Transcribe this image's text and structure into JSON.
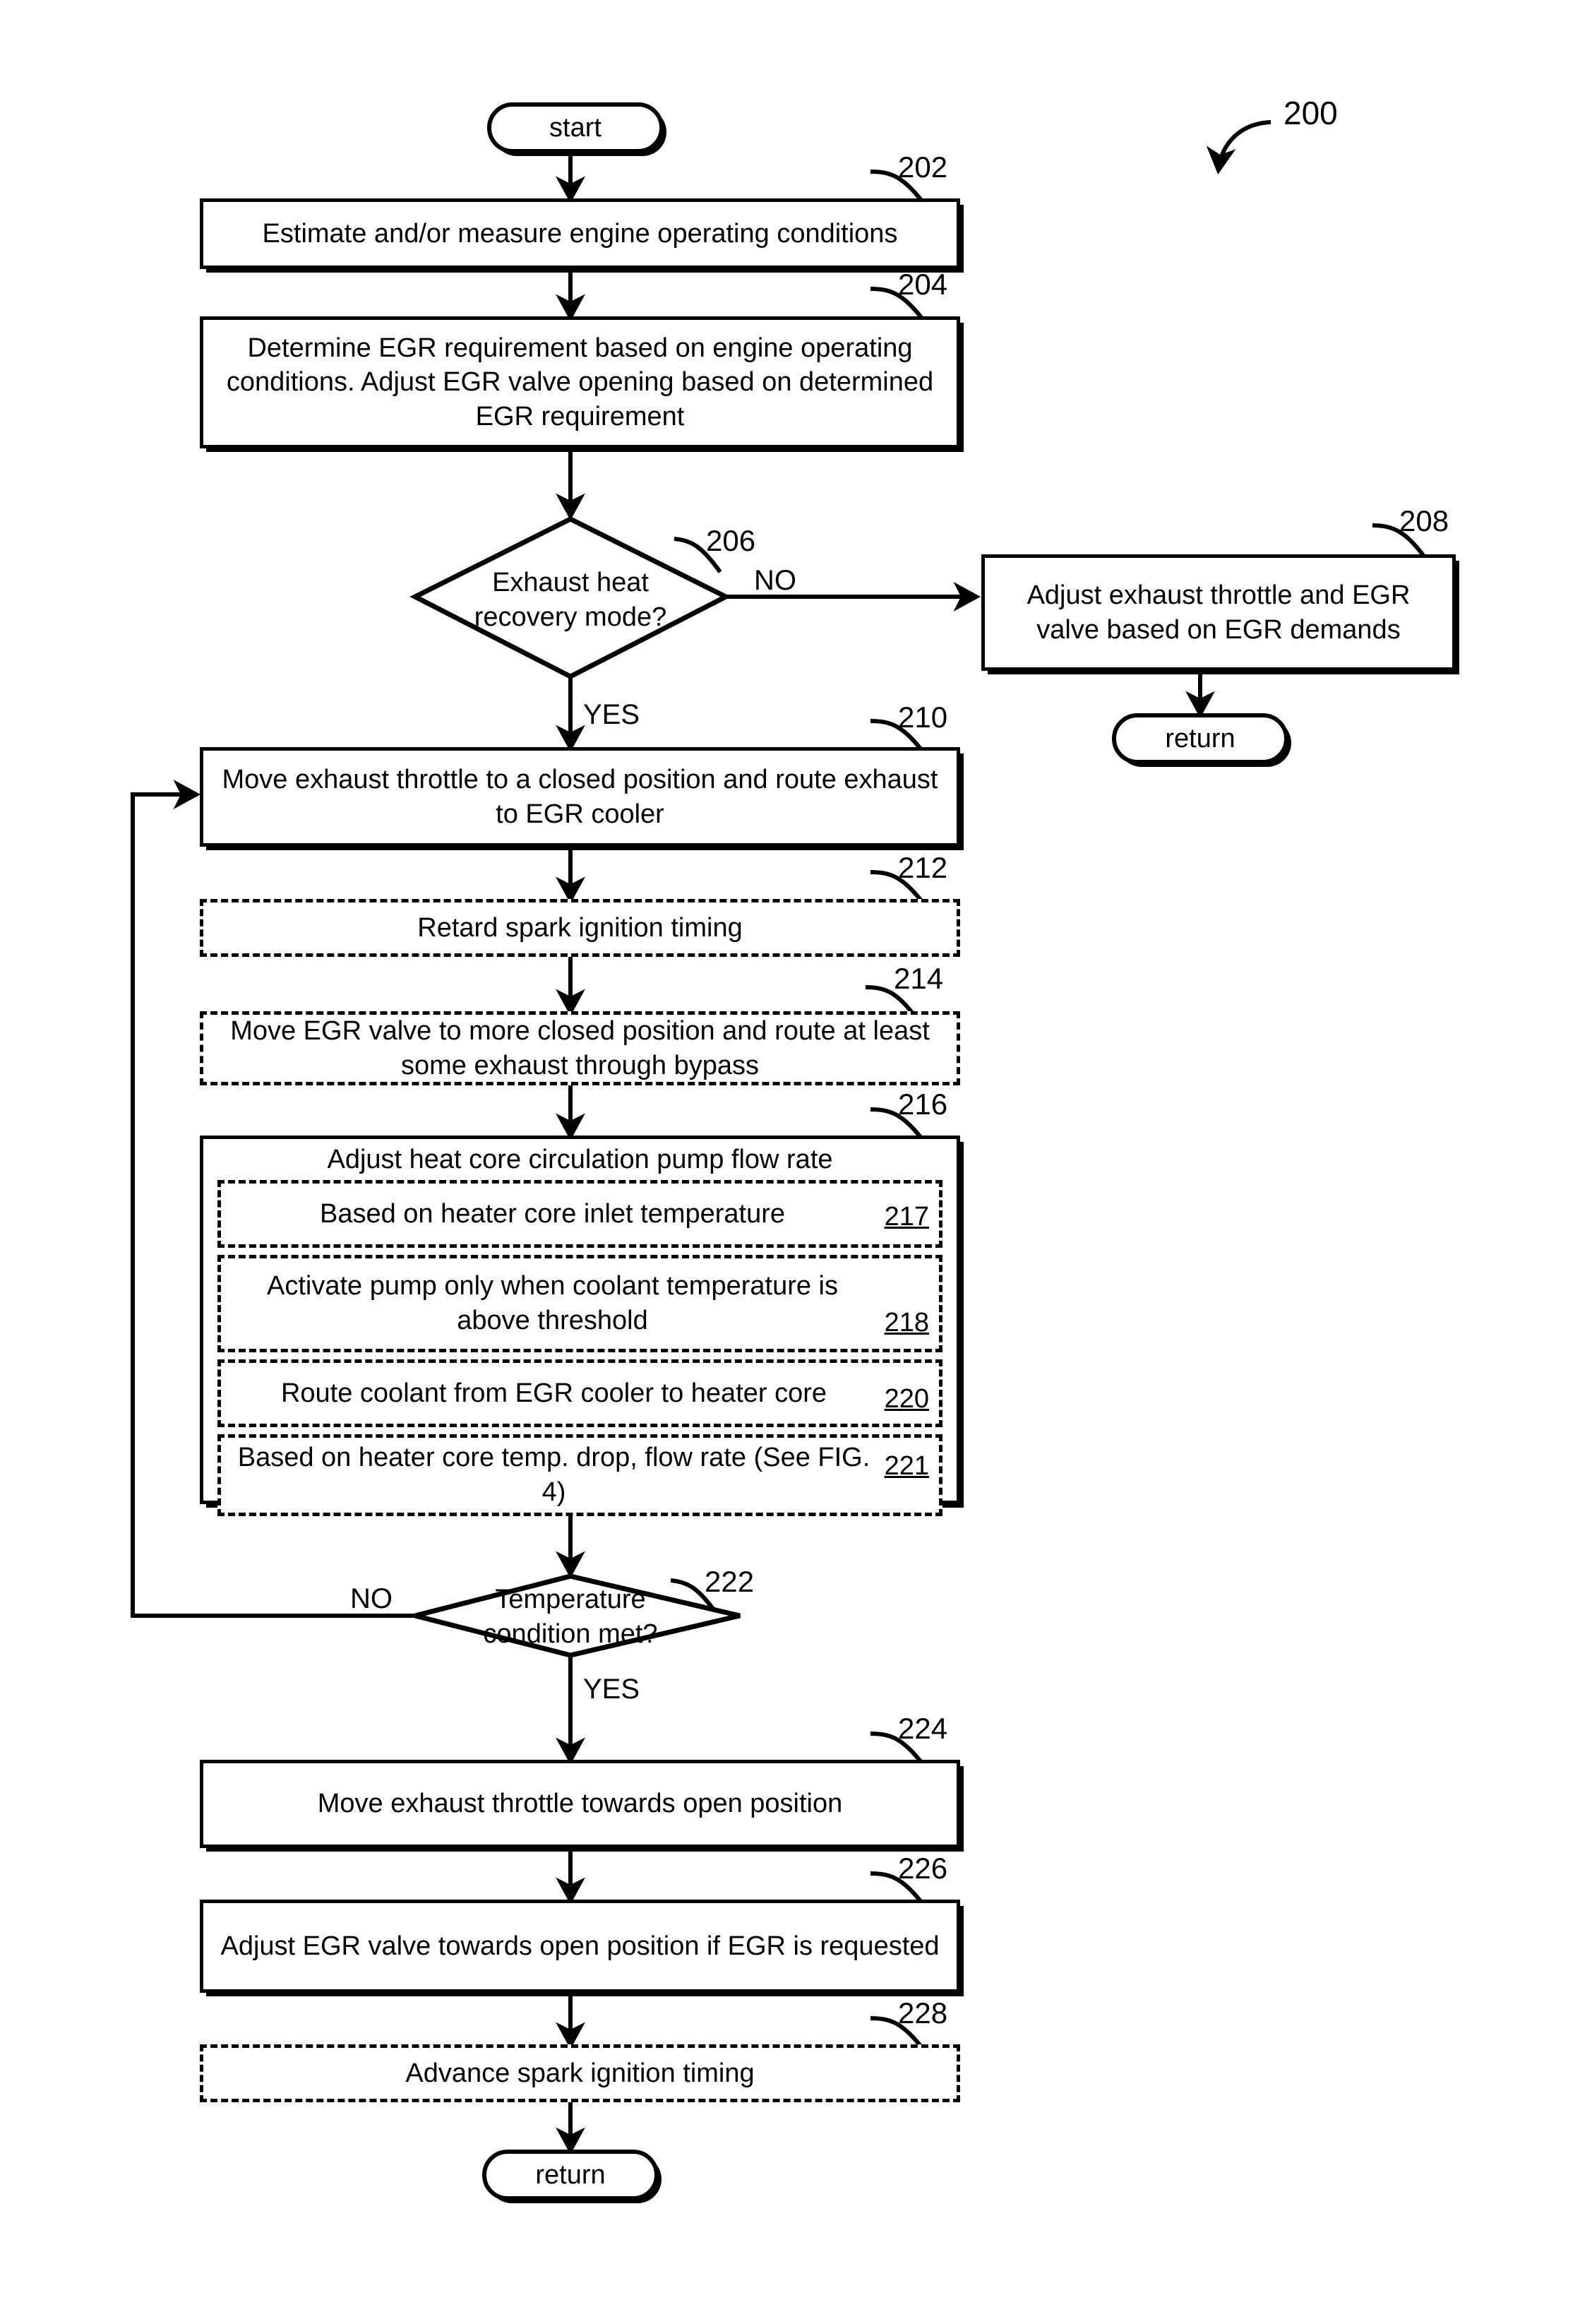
{
  "figure": {
    "reference_numeral": "200",
    "start_label": "start",
    "return_label": "return"
  },
  "nodes": [
    {
      "id": "start",
      "ref": "",
      "type": "terminator",
      "text": "start"
    },
    {
      "id": "202",
      "ref": "202",
      "type": "process",
      "text": "Estimate and/or measure engine operating conditions"
    },
    {
      "id": "204",
      "ref": "204",
      "type": "process",
      "text": "Determine EGR requirement based on engine operating conditions. Adjust EGR valve opening based on determined EGR requirement"
    },
    {
      "id": "206",
      "ref": "206",
      "type": "decision",
      "text_line1": "Exhaust heat",
      "text_line2": "recovery mode?"
    },
    {
      "id": "208",
      "ref": "208",
      "type": "process",
      "text": "Adjust exhaust throttle and EGR valve based on EGR demands"
    },
    {
      "id": "return_right",
      "ref": "",
      "type": "terminator",
      "text": "return"
    },
    {
      "id": "210",
      "ref": "210",
      "type": "process",
      "text": "Move exhaust throttle to a closed position and route exhaust to EGR cooler"
    },
    {
      "id": "212",
      "ref": "212",
      "type": "optional",
      "text": "Retard spark ignition timing"
    },
    {
      "id": "214",
      "ref": "214",
      "type": "optional",
      "text": "Move EGR valve to more closed position and route at least some exhaust through bypass"
    },
    {
      "id": "216",
      "ref": "216",
      "type": "process",
      "text": "Adjust heat core circulation pump flow rate"
    },
    {
      "id": "217",
      "ref": "217",
      "type": "optional-sub",
      "text": "Based on heater core inlet temperature",
      "num": "217"
    },
    {
      "id": "218",
      "ref": "218",
      "type": "optional-sub",
      "text": "Activate pump only when coolant temperature is above threshold",
      "num": "218"
    },
    {
      "id": "220",
      "ref": "220",
      "type": "optional-sub",
      "text": "Route coolant from EGR cooler to heater core",
      "num": "220"
    },
    {
      "id": "221",
      "ref": "221",
      "type": "optional-sub",
      "text": "Based on heater core temp. drop, flow rate (See FIG. 4)",
      "num": "221"
    },
    {
      "id": "222",
      "ref": "222",
      "type": "decision",
      "text_line1": "Temperature",
      "text_line2": "condition met?"
    },
    {
      "id": "224",
      "ref": "224",
      "type": "process",
      "text": "Move exhaust throttle towards open position"
    },
    {
      "id": "226",
      "ref": "226",
      "type": "process",
      "text": "Adjust EGR valve towards open position if EGR is requested"
    },
    {
      "id": "228",
      "ref": "228",
      "type": "optional",
      "text": "Advance spark ignition timing"
    },
    {
      "id": "return_bottom",
      "ref": "",
      "type": "terminator",
      "text": "return"
    }
  ],
  "branch_labels": {
    "d206_no": "NO",
    "d206_yes": "YES",
    "d222_no": "NO",
    "d222_yes": "YES"
  },
  "sub_numbers": {
    "n217": "217",
    "n218": "218",
    "n220": "220",
    "n221": "221"
  },
  "refs": {
    "r200": "200",
    "r202": "202",
    "r204": "204",
    "r206": "206",
    "r208": "208",
    "r210": "210",
    "r212": "212",
    "r214": "214",
    "r216": "216",
    "r222": "222",
    "r224": "224",
    "r226": "226",
    "r228": "228"
  },
  "colors": {
    "ink": "#000000",
    "paper": "#ffffff"
  }
}
